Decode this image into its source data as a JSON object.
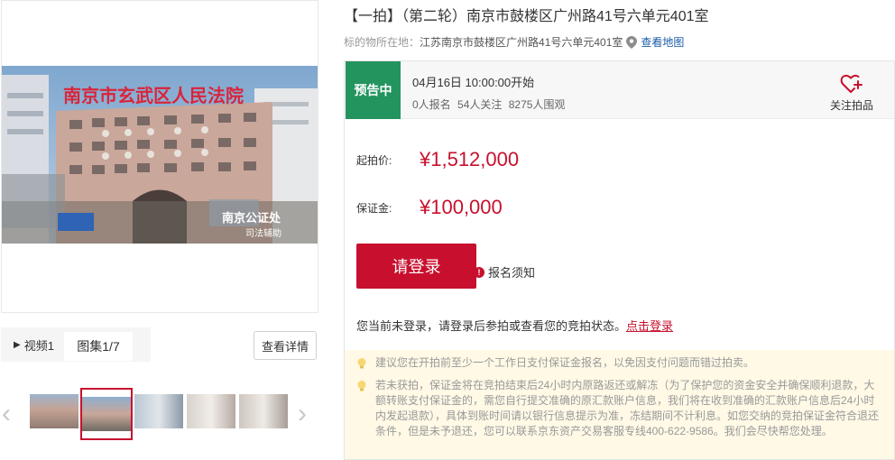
{
  "gallery": {
    "watermark_court": "南京市玄武区人民法院",
    "watermark_brand": "南京公证处",
    "watermark_sub": "司法辅助",
    "video_tab": "视频1",
    "gallery_tab": "图集1/7",
    "detail_button": "查看详情",
    "arrow_prev": "‹",
    "arrow_next": "›"
  },
  "item": {
    "title": "【一拍】（第二轮）南京市鼓楼区广州路41号六单元401室",
    "location_label": "标的物所在地：",
    "location_value": "江苏南京市鼓楼区广州路41号六单元401室",
    "map_link": "查看地图"
  },
  "status": {
    "badge": "预告中",
    "start_time": "04月16日 10:00:00开始",
    "signups": "0人报名",
    "followers": "54人关注",
    "viewers": "8275人围观",
    "follow_label": "关注拍品"
  },
  "prices": {
    "start_label": "起拍价:",
    "start_value": "¥1,512,000",
    "deposit_label": "保证金:",
    "deposit_value": "¥100,000"
  },
  "actions": {
    "login_button": "请登录",
    "notice_icon": "!",
    "notice_link": "报名须知",
    "login_hint": "您当前未登录，请登录后参拍或查看您的竞拍状态。",
    "login_hint_link": "点击登录"
  },
  "tips": [
    "建议您在开拍前至少一个工作日支付保证金报名，以免因支付问题而错过拍卖。",
    "若未获拍，保证金将在竞拍结束后24小时内原路返还或解冻（为了保护您的资金安全并确保顺利退款，大额转账支付保证金的，需您自行提交准确的原汇款账户信息，我们将在收到准确的汇款账户信息后24小时内发起退款），具体到账时间请以银行信息提示为准，冻结期间不计利息。如您交纳的竞拍保证金符合退还条件，但是未予退还，您可以联系京东资产交易客服专线400-622-9586。我们会尽快帮您处理。"
  ],
  "colors": {
    "accent_red": "#c8102e",
    "status_green": "#24945f",
    "tips_bg": "#fff9e6",
    "link_blue": "#1a5ca8"
  }
}
